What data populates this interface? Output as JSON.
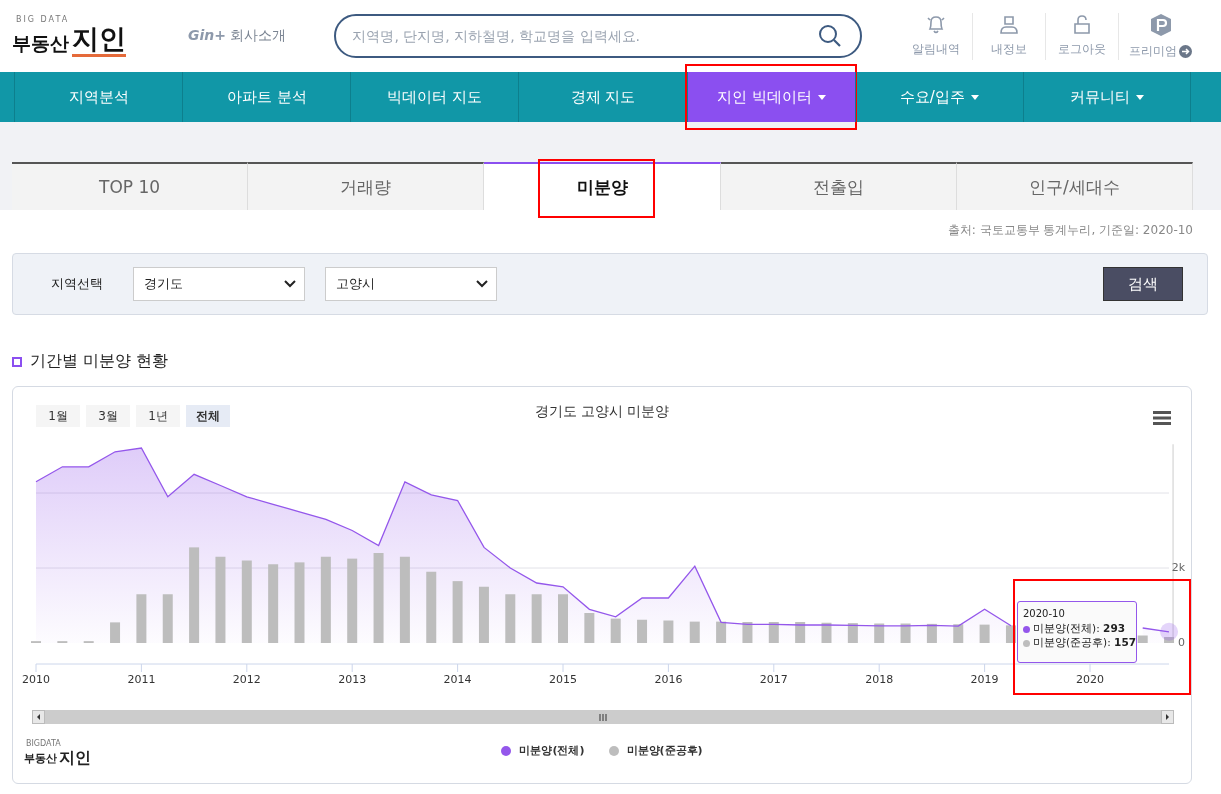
{
  "header": {
    "logo": {
      "tagline": "BIG DATA",
      "name": "부동산",
      "brand": "지인"
    },
    "company_link": {
      "badge": "Gin+",
      "label": "회사소개"
    },
    "search": {
      "placeholder": "지역명, 단지명, 지하철명, 학교명을 입력세요."
    },
    "user_menu": [
      {
        "kind": "bell",
        "label": "알림내역"
      },
      {
        "kind": "user",
        "label": "내정보"
      },
      {
        "kind": "lock",
        "label": "로그아웃"
      },
      {
        "kind": "premium",
        "label": "프리미엄"
      }
    ]
  },
  "nav": [
    {
      "label": "지역분석",
      "dropdown": false,
      "selected": false,
      "highlighted": false
    },
    {
      "label": "아파트 분석",
      "dropdown": false,
      "selected": false,
      "highlighted": false
    },
    {
      "label": "빅데이터 지도",
      "dropdown": false,
      "selected": false,
      "highlighted": false
    },
    {
      "label": "경제 지도",
      "dropdown": false,
      "selected": false,
      "highlighted": false
    },
    {
      "label": "지인 빅데이터",
      "dropdown": true,
      "selected": true,
      "highlighted": true
    },
    {
      "label": "수요/입주",
      "dropdown": true,
      "selected": false,
      "highlighted": false
    },
    {
      "label": "커뮤니티",
      "dropdown": true,
      "selected": false,
      "highlighted": false
    }
  ],
  "tabs": [
    {
      "label": "TOP 10",
      "selected": false,
      "highlighted": false
    },
    {
      "label": "거래량",
      "selected": false,
      "highlighted": false
    },
    {
      "label": "미분양",
      "selected": true,
      "highlighted": true
    },
    {
      "label": "전출입",
      "selected": false,
      "highlighted": false
    },
    {
      "label": "인구/세대수",
      "selected": false,
      "highlighted": false
    }
  ],
  "source_note": "출처: 국토교통부 통계누리,  기준일: 2020-10",
  "filter": {
    "label": "지역선택",
    "selects": [
      {
        "value": "경기도"
      },
      {
        "value": "고양시"
      }
    ],
    "button": "검색"
  },
  "section_title": "기간별 미분양 현황",
  "chart_panel": {
    "range_buttons": [
      {
        "label": "1월",
        "selected": false
      },
      {
        "label": "3월",
        "selected": false
      },
      {
        "label": "1년",
        "selected": false
      },
      {
        "label": "전체",
        "selected": true
      }
    ],
    "chart_data": {
      "type": "area",
      "title": "경기도 고양시 미분양",
      "x": [
        2010,
        2010.25,
        2010.5,
        2010.75,
        2011,
        2011.25,
        2011.5,
        2011.75,
        2012,
        2012.25,
        2012.5,
        2012.75,
        2013,
        2013.25,
        2013.5,
        2013.75,
        2014,
        2014.25,
        2014.5,
        2014.75,
        2015,
        2015.25,
        2015.5,
        2015.75,
        2016,
        2016.25,
        2016.5,
        2016.75,
        2017,
        2017.25,
        2017.5,
        2017.75,
        2018,
        2018.25,
        2018.5,
        2018.75,
        2019,
        2019.25,
        2019.5,
        2019.75,
        2020,
        2020.25,
        2020.5,
        2020.75
      ],
      "series": [
        {
          "name": "미분양(전체)",
          "color": "#9457eb",
          "type": "area",
          "values": [
            4300,
            4700,
            4700,
            5100,
            5200,
            3900,
            4500,
            4200,
            3900,
            3700,
            3500,
            3300,
            3000,
            2600,
            4300,
            3950,
            3800,
            2550,
            2000,
            1600,
            1500,
            900,
            700,
            1200,
            1200,
            2050,
            550,
            500,
            500,
            480,
            480,
            470,
            460,
            460,
            470,
            450,
            900,
            460,
            null,
            null,
            null,
            null,
            400,
            300
          ]
        },
        {
          "name": "미분양(준공후)",
          "color": "#bdbdbd",
          "type": "bar",
          "values": [
            50,
            50,
            50,
            550,
            1300,
            1300,
            2550,
            2300,
            2200,
            2100,
            2150,
            2300,
            2250,
            2400,
            2300,
            1900,
            1650,
            1500,
            1300,
            1300,
            1300,
            800,
            650,
            620,
            600,
            570,
            570,
            560,
            560,
            560,
            540,
            530,
            520,
            520,
            510,
            500,
            490,
            470,
            null,
            null,
            null,
            null,
            200,
            160
          ]
        }
      ],
      "xlim": [
        2010,
        2020.75
      ],
      "ylim": [
        0,
        5300
      ],
      "xticks": [
        2010,
        2011,
        2012,
        2013,
        2014,
        2015,
        2016,
        2017,
        2018,
        2019,
        2020
      ],
      "yticks": [
        {
          "value": 0,
          "label": "0"
        },
        {
          "value": 2000,
          "label": "2k"
        }
      ]
    },
    "tooltip": {
      "title": "2020-10",
      "highlighted": true,
      "rows": [
        {
          "text": "미분양(전체): **293**",
          "color": "#9457eb"
        },
        {
          "text": "미분양(준공후): **157**",
          "color": "#bdbdbd"
        }
      ]
    },
    "footer_logo": {
      "tagline": "BIGDATA",
      "name": "부동산",
      "brand": "지인"
    }
  }
}
